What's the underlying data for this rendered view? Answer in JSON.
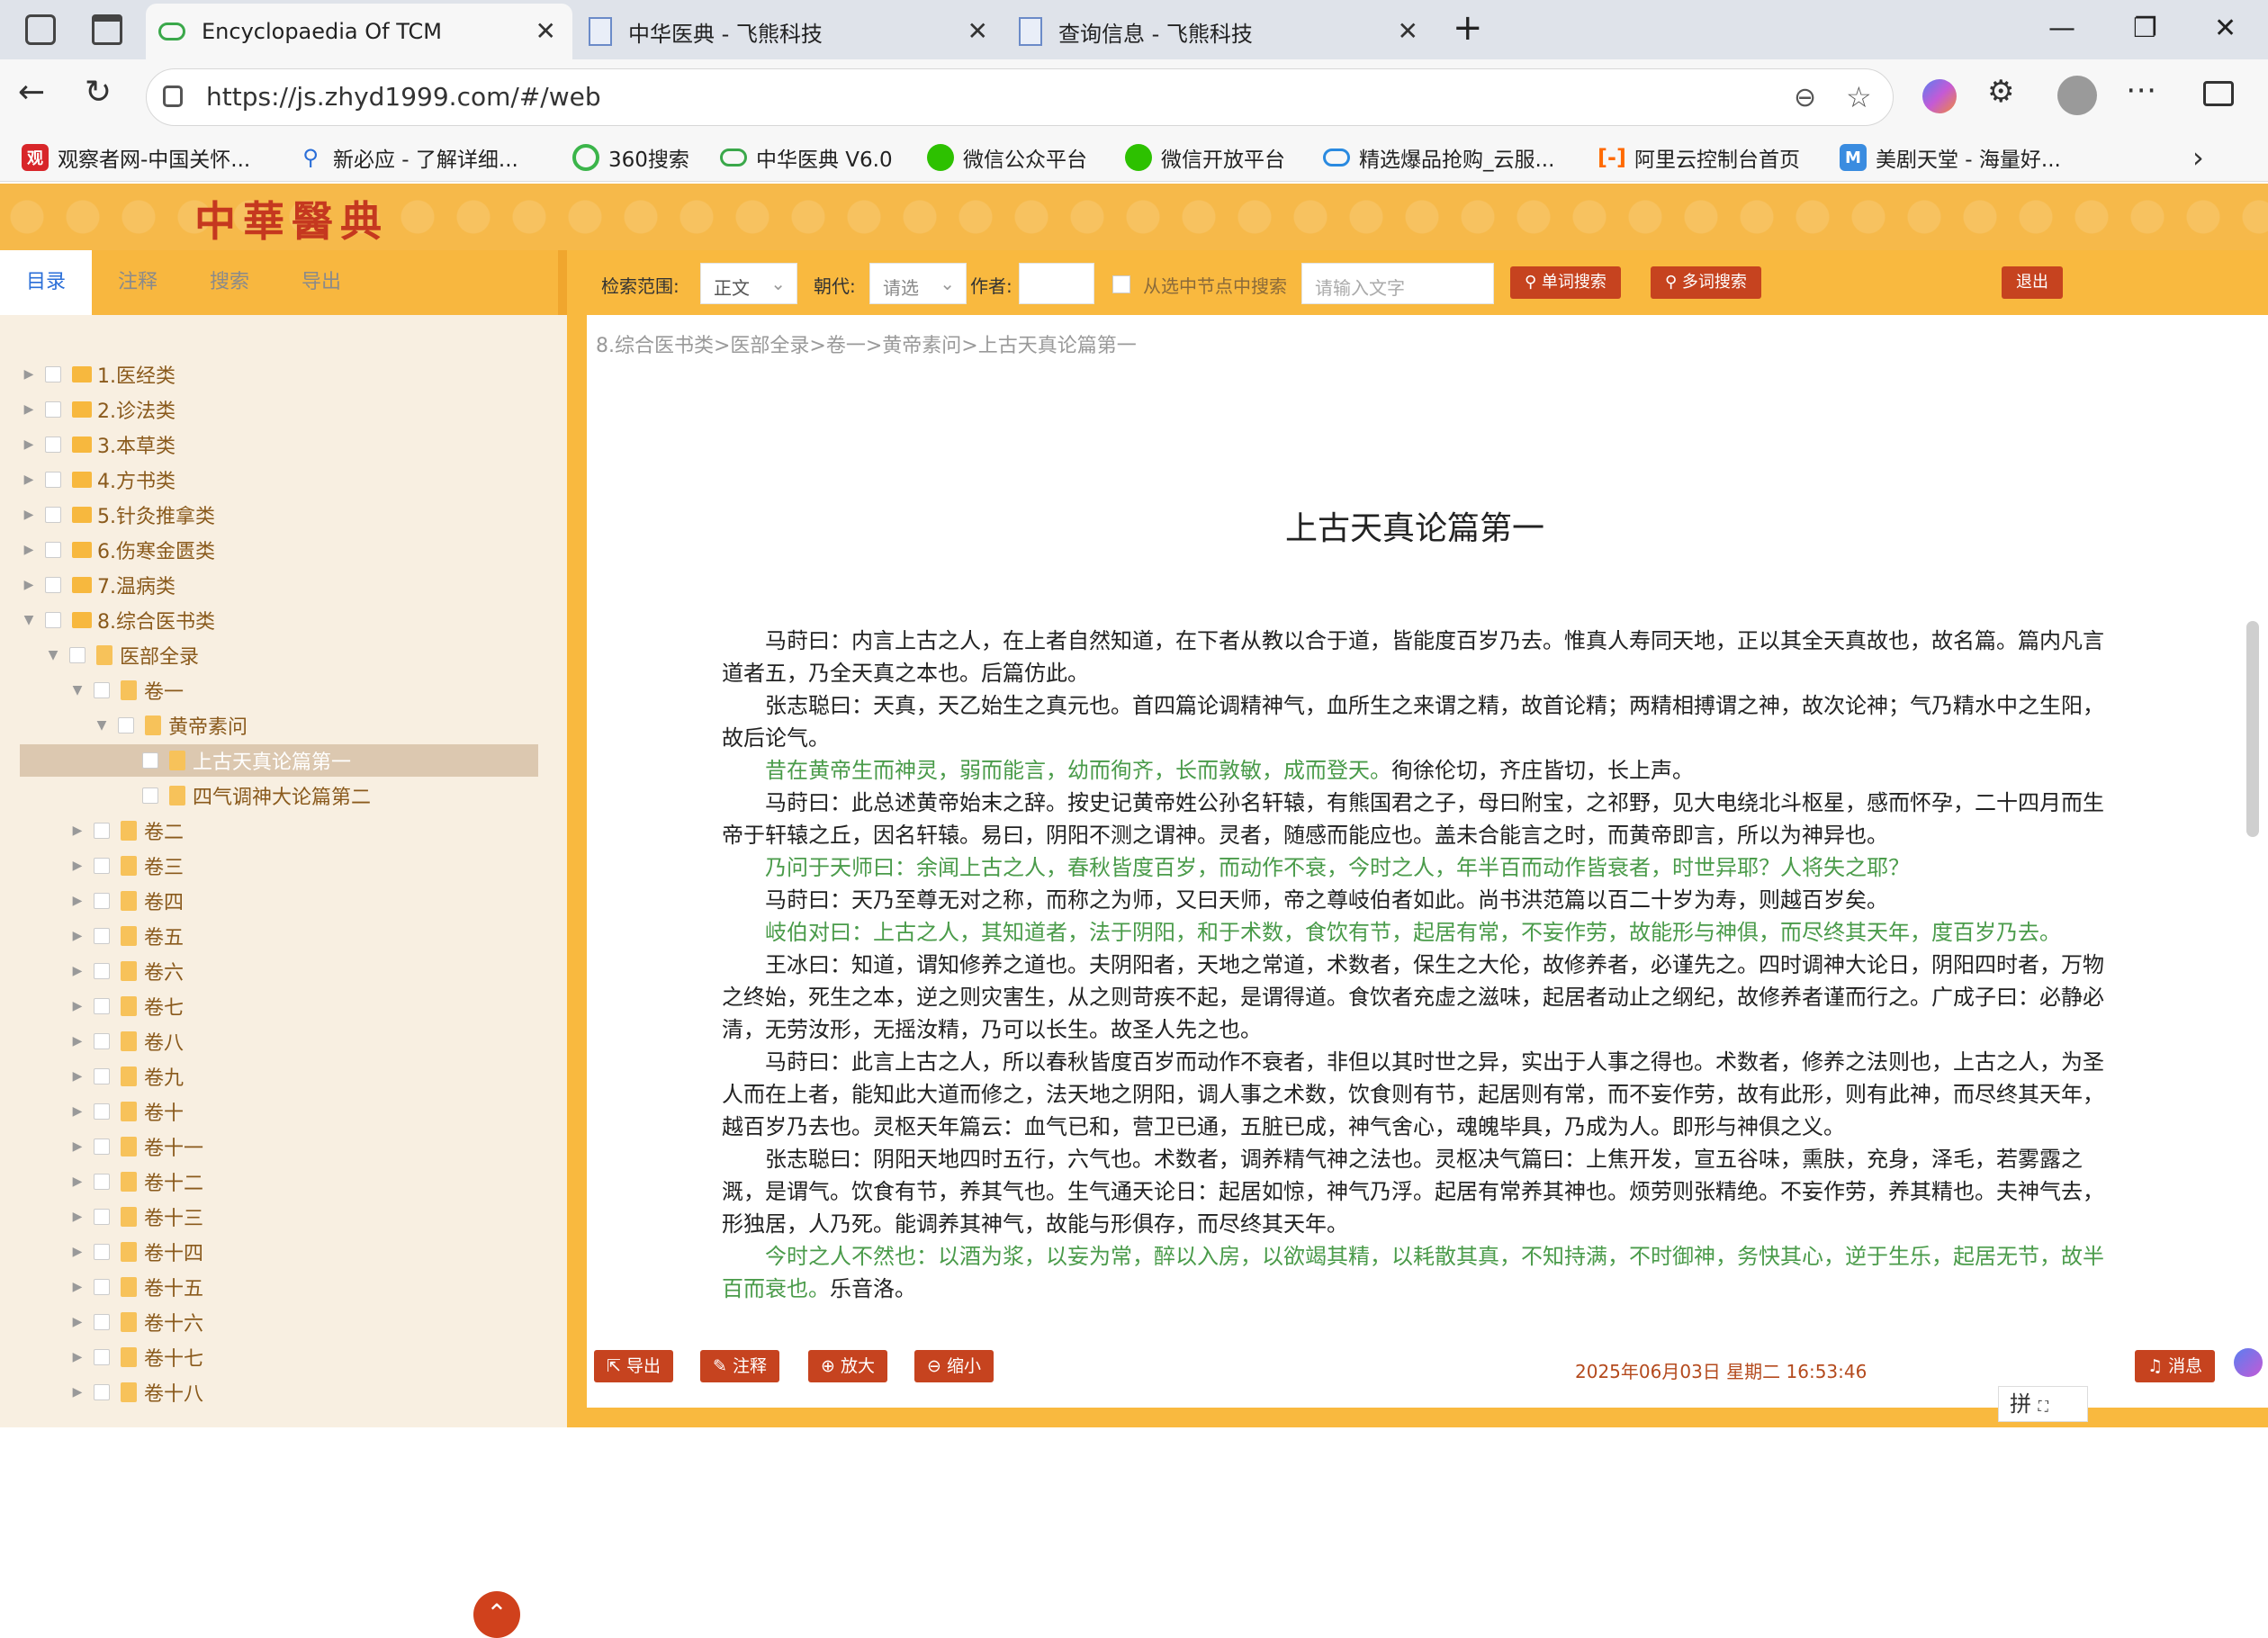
{
  "browser": {
    "tabs": [
      {
        "title": "Encyclopaedia Of TCM",
        "active": true
      },
      {
        "title": "中华医典 - 飞熊科技",
        "active": false
      },
      {
        "title": "查询信息 - 飞熊科技",
        "active": false
      }
    ],
    "url": "https://js.zhyd1999.com/#/web",
    "bookmarks": [
      "观察者网-中国关怀...",
      "新必应 - 了解详细...",
      "360搜索",
      "中华医典 V6.0",
      "微信公众平台",
      "微信开放平台",
      "精选爆品抢购_云服...",
      "阿里云控制台首页",
      "美剧天堂 - 海量好..."
    ]
  },
  "site": {
    "logo": "中華醫典"
  },
  "left": {
    "tabs": [
      "目录",
      "注释",
      "搜索",
      "导出"
    ],
    "tree": [
      {
        "label": "1.医经类",
        "level": 0,
        "type": "folder",
        "exp": "closed"
      },
      {
        "label": "2.诊法类",
        "level": 0,
        "type": "folder",
        "exp": "closed"
      },
      {
        "label": "3.本草类",
        "level": 0,
        "type": "folder",
        "exp": "closed"
      },
      {
        "label": "4.方书类",
        "level": 0,
        "type": "folder",
        "exp": "closed"
      },
      {
        "label": "5.针灸推拿类",
        "level": 0,
        "type": "folder",
        "exp": "closed"
      },
      {
        "label": "6.伤寒金匮类",
        "level": 0,
        "type": "folder",
        "exp": "closed"
      },
      {
        "label": "7.温病类",
        "level": 0,
        "type": "folder",
        "exp": "closed"
      },
      {
        "label": "8.综合医书类",
        "level": 0,
        "type": "folder",
        "exp": "open"
      },
      {
        "label": "医部全录",
        "level": 1,
        "type": "book",
        "exp": "open"
      },
      {
        "label": "卷一",
        "level": 2,
        "type": "book",
        "exp": "open"
      },
      {
        "label": "黄帝素问",
        "level": 3,
        "type": "book",
        "exp": "open"
      },
      {
        "label": "上古天真论篇第一",
        "level": 4,
        "type": "book",
        "exp": "none",
        "selected": true
      },
      {
        "label": "四气调神大论篇第二",
        "level": 4,
        "type": "book",
        "exp": "none"
      },
      {
        "label": "卷二",
        "level": 2,
        "type": "book",
        "exp": "closed"
      },
      {
        "label": "卷三",
        "level": 2,
        "type": "book",
        "exp": "closed"
      },
      {
        "label": "卷四",
        "level": 2,
        "type": "book",
        "exp": "closed"
      },
      {
        "label": "卷五",
        "level": 2,
        "type": "book",
        "exp": "closed"
      },
      {
        "label": "卷六",
        "level": 2,
        "type": "book",
        "exp": "closed"
      },
      {
        "label": "卷七",
        "level": 2,
        "type": "book",
        "exp": "closed"
      },
      {
        "label": "卷八",
        "level": 2,
        "type": "book",
        "exp": "closed"
      },
      {
        "label": "卷九",
        "level": 2,
        "type": "book",
        "exp": "closed"
      },
      {
        "label": "卷十",
        "level": 2,
        "type": "book",
        "exp": "closed"
      },
      {
        "label": "卷十一",
        "level": 2,
        "type": "book",
        "exp": "closed"
      },
      {
        "label": "卷十二",
        "level": 2,
        "type": "book",
        "exp": "closed"
      },
      {
        "label": "卷十三",
        "level": 2,
        "type": "book",
        "exp": "closed"
      },
      {
        "label": "卷十四",
        "level": 2,
        "type": "book",
        "exp": "closed"
      },
      {
        "label": "卷十五",
        "level": 2,
        "type": "book",
        "exp": "closed"
      },
      {
        "label": "卷十六",
        "level": 2,
        "type": "book",
        "exp": "closed"
      },
      {
        "label": "卷十七",
        "level": 2,
        "type": "book",
        "exp": "closed"
      },
      {
        "label": "卷十八",
        "level": 2,
        "type": "book",
        "exp": "closed"
      }
    ]
  },
  "toolbar": {
    "scope_label": "检索范围:",
    "scope_value": "正文",
    "dynasty_label": "朝代:",
    "dynasty_value": "请选",
    "author_label": "作者:",
    "checkbox_label": "从选中节点中搜索",
    "search_placeholder": "请输入文字",
    "single_search": "单词搜索",
    "multi_search": "多词搜索",
    "logout": "退出"
  },
  "doc": {
    "breadcrumb": "8.综合医书类>医部全录>卷一>黄帝素问>上古天真论篇第一",
    "title": "上古天真论篇第一",
    "paragraphs": [
      {
        "text": "马莳曰：内言上古之人，在上者自然知道，在下者从教以合于道，皆能度百岁乃去。惟真人寿同天地，正以其全天真故也，故名篇。篇内凡言道者五，乃全天真之本也。后篇仿此。",
        "green": false
      },
      {
        "text": "张志聪曰：天真，天乙始生之真元也。首四篇论调精神气，血所生之来谓之精，故首论精；两精相搏谓之神，故次论神；气乃精水中之生阳，故后论气。",
        "green": false
      },
      {
        "text": "昔在黄帝生而神灵，弱而能言，幼而徇齐，长而敦敏，成而登天。",
        "tail": "徇徐伦切，齐庄皆切，长上声。",
        "green": true
      },
      {
        "text": "马莳曰：此总述黄帝始末之辞。按史记黄帝姓公孙名轩辕，有熊国君之子，母曰附宝，之祁野，见大电绕北斗枢星，感而怀孕，二十四月而生帝于轩辕之丘，因名轩辕。易曰，阴阳不测之谓神。灵者，随感而能应也。盖未合能言之时，而黄帝即言，所以为神异也。",
        "green": false
      },
      {
        "text": "乃问于天师曰：余闻上古之人，春秋皆度百岁，而动作不衰，今时之人，年半百而动作皆衰者，时世异耶？人将失之耶？",
        "green": true
      },
      {
        "text": "马莳曰：天乃至尊无对之称，而称之为师，又曰天师，帝之尊岐伯者如此。尚书洪范篇以百二十岁为寿，则越百岁矣。",
        "green": false
      },
      {
        "text": "岐伯对曰：上古之人，其知道者，法于阴阳，和于术数，食饮有节，起居有常，不妄作劳，故能形与神俱，而尽终其天年，度百岁乃去。",
        "green": true
      },
      {
        "text": "王冰曰：知道，谓知修养之道也。夫阴阳者，天地之常道，术数者，保生之大伦，故修养者，必谨先之。四时调神大论日，阴阳四时者，万物之终始，死生之本，逆之则灾害生，从之则苛疾不起，是谓得道。食饮者充虚之滋味，起居者动止之纲纪，故修养者谨而行之。广成子曰：必静必清，无劳汝形，无摇汝精，乃可以长生。故圣人先之也。",
        "green": false
      },
      {
        "text": "马莳曰：此言上古之人，所以春秋皆度百岁而动作不衰者，非但以其时世之异，实出于人事之得也。术数者，修养之法则也，上古之人，为圣人而在上者，能知此大道而修之，法天地之阴阳，调人事之术数，饮食则有节，起居则有常，而不妄作劳，故有此形，则有此神，而尽终其天年，越百岁乃去也。灵枢天年篇云：血气已和，营卫已通，五脏已成，神气舍心，魂魄毕具，乃成为人。即形与神俱之义。",
        "green": false
      },
      {
        "text": "张志聪曰：阴阳天地四时五行，六气也。术数者，调养精气神之法也。灵枢决气篇曰：上焦开发，宣五谷味，熏肤，充身，泽毛，若雾露之溉，是谓气。饮食有节，养其气也。生气通天论日：起居如惊，神气乃浮。起居有常养其神也。烦劳则张精绝。不妄作劳，养其精也。夫神气去，形独居，人乃死。能调养其神气，故能与形俱存，而尽终其天年。",
        "green": false
      },
      {
        "text": "今时之人不然也：以酒为浆，以妄为常，醉以入房，以欲竭其精，以耗散其真，不知持满，不时御神，务快其心，逆于生乐，起居无节，故半百而衰也。",
        "tail": "乐音洛。",
        "green": true
      }
    ]
  },
  "bottom": {
    "export": "导出",
    "annotate": "注释",
    "zoom_in": "放大",
    "zoom_out": "缩小",
    "datetime": "2025年06月03日 星期二 16:53:46",
    "message": "消息",
    "ime": "拼"
  },
  "colors": {
    "orange": "#f9b93f",
    "red_button": "#c6431f",
    "green_text": "#4a9b4a",
    "tree_text": "#8a5a1c"
  }
}
